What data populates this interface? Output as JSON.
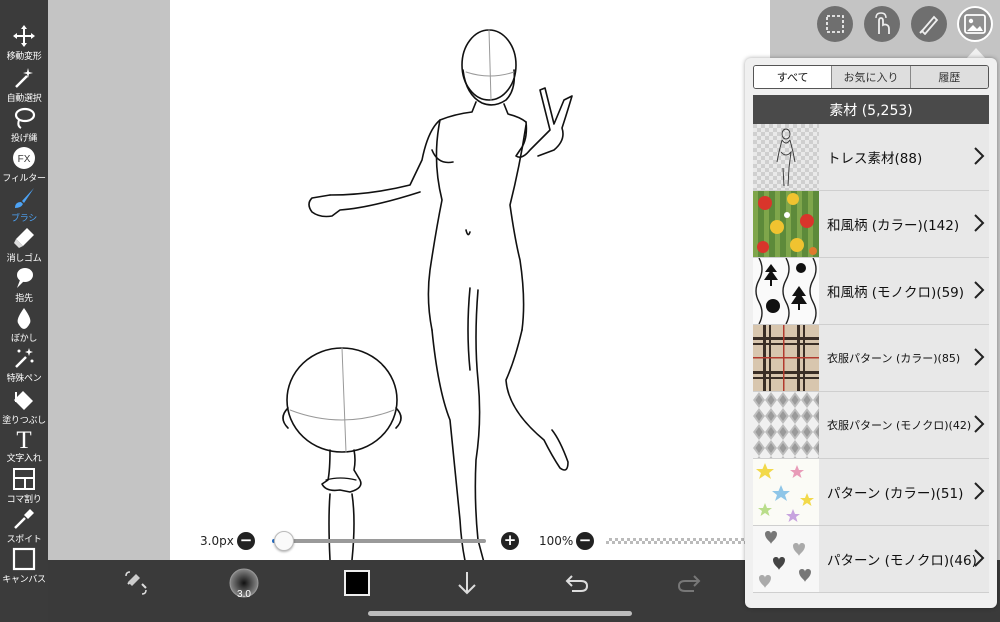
{
  "tools": [
    {
      "id": "move",
      "label": "移動変形",
      "icon": "move-arrows-icon"
    },
    {
      "id": "magic",
      "label": "自動選択",
      "icon": "magic-wand-icon"
    },
    {
      "id": "lasso",
      "label": "投げ縄",
      "icon": "lasso-icon"
    },
    {
      "id": "filter",
      "label": "フィルター",
      "icon": "fx-filter-icon",
      "glyph": "FX"
    },
    {
      "id": "brush",
      "label": "ブラシ",
      "icon": "brush-icon",
      "active": true
    },
    {
      "id": "eraser",
      "label": "消しゴム",
      "icon": "eraser-icon"
    },
    {
      "id": "finger",
      "label": "指先",
      "icon": "finger-smudge-icon"
    },
    {
      "id": "blur",
      "label": "ぼかし",
      "icon": "blur-drop-icon"
    },
    {
      "id": "special",
      "label": "特殊ペン",
      "icon": "special-pen-icon"
    },
    {
      "id": "fill",
      "label": "塗りつぶし",
      "icon": "paint-bucket-icon"
    },
    {
      "id": "text",
      "label": "文字入れ",
      "icon": "text-icon",
      "glyph": "T"
    },
    {
      "id": "panel",
      "label": "コマ割り",
      "icon": "panel-divide-icon"
    },
    {
      "id": "eyedropper",
      "label": "スポイト",
      "icon": "eyedropper-icon"
    },
    {
      "id": "canvas",
      "label": "キャンバス",
      "icon": "canvas-icon"
    }
  ],
  "brush": {
    "size_label": "3.0px",
    "minus": "−",
    "plus": "+",
    "size_fraction": 0.03,
    "zoom_label": "100%",
    "badge": "3.0"
  },
  "colors": {
    "current": "#000000",
    "accent": "#4da3f5",
    "slider": "#2a72c9"
  },
  "top_buttons": [
    {
      "id": "select",
      "icon": "selection-rect-icon"
    },
    {
      "id": "touch",
      "icon": "touch-hand-icon"
    },
    {
      "id": "ruler",
      "icon": "ruler-pen-icon"
    },
    {
      "id": "material",
      "icon": "material-image-icon",
      "active": true
    }
  ],
  "material_panel": {
    "tabs": [
      {
        "label": "すべて",
        "selected": true
      },
      {
        "label": "お気に入り",
        "selected": false
      },
      {
        "label": "履歴",
        "selected": false
      }
    ],
    "header": "素材 (5,253)",
    "items": [
      {
        "label": "トレス素材(88)",
        "thumb": "trace"
      },
      {
        "label": "和風柄 (カラー)(142)",
        "thumb": "wa-color"
      },
      {
        "label": "和風柄 (モノクロ)(59)",
        "thumb": "wa-mono"
      },
      {
        "label": "衣服パターン (カラー)(85)",
        "thumb": "plaid",
        "small": true
      },
      {
        "label": "衣服パターン (モノクロ)(42)",
        "thumb": "argyle",
        "small": true
      },
      {
        "label": "パターン (カラー)(51)",
        "thumb": "stars"
      },
      {
        "label": "パターン (モノクロ)(46)",
        "thumb": "hearts"
      }
    ]
  }
}
